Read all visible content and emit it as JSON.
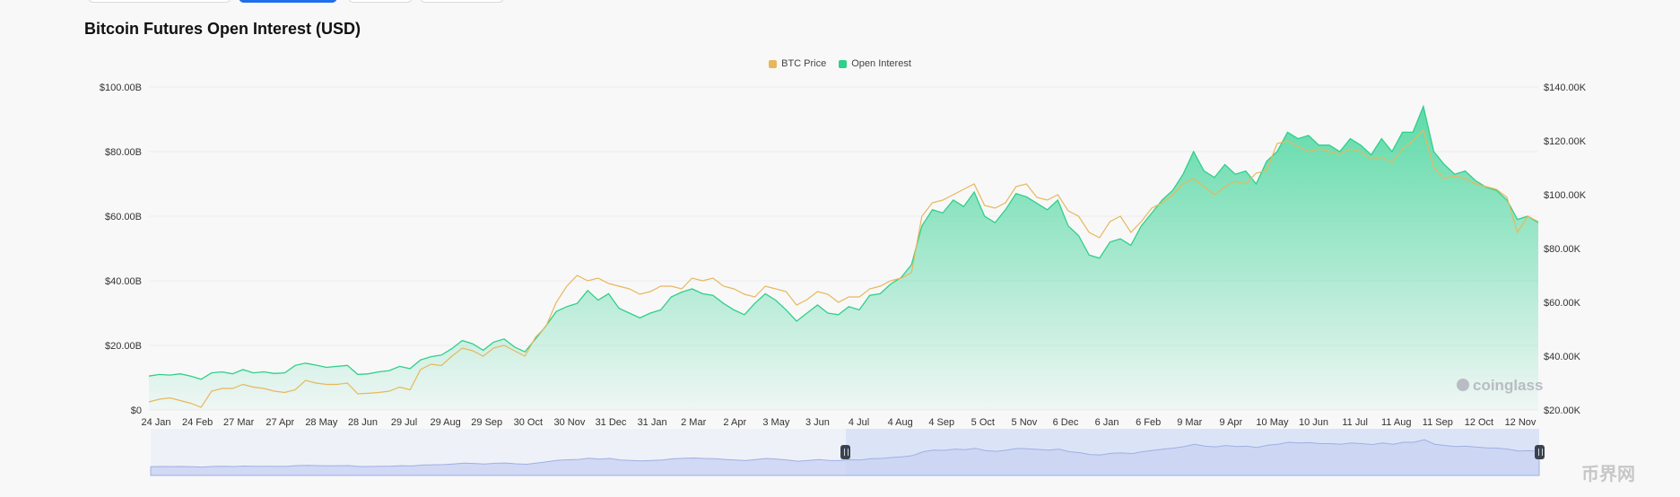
{
  "tabs_top": [
    "",
    "",
    "",
    ""
  ],
  "title": "Bitcoin Futures Open Interest (USD)",
  "legend": [
    {
      "label": "BTC Price",
      "color": "#e7b85b"
    },
    {
      "label": "Open Interest",
      "color": "#2fd089"
    }
  ],
  "watermark": "coinglass",
  "site_mark": "币界网",
  "chart_data": {
    "type": "area",
    "title": "Bitcoin Futures Open Interest (USD)",
    "x_ticks": [
      "24 Jan",
      "24 Feb",
      "27 Mar",
      "27 Apr",
      "28 May",
      "28 Jun",
      "29 Jul",
      "29 Aug",
      "29 Sep",
      "30 Oct",
      "30 Nov",
      "31 Dec",
      "31 Jan",
      "2 Mar",
      "2 Apr",
      "3 May",
      "3 Jun",
      "4 Jul",
      "4 Aug",
      "4 Sep",
      "5 Oct",
      "5 Nov",
      "6 Dec",
      "6 Jan",
      "6 Feb",
      "9 Mar",
      "9 Apr",
      "10 May",
      "10 Jun",
      "11 Jul",
      "11 Aug",
      "11 Sep",
      "12 Oct",
      "12 Nov"
    ],
    "y_left": {
      "ticks": [
        "$0",
        "$20.00B",
        "$40.00B",
        "$60.00B",
        "$80.00B",
        "$100.00B"
      ],
      "range": [
        0,
        100
      ],
      "unit": "B USD"
    },
    "y_right": {
      "ticks": [
        "$20.00K",
        "$40.00K",
        "$60.00K",
        "$80.00K",
        "$100.00K",
        "$120.00K",
        "$140.00K"
      ],
      "range": [
        20,
        140
      ],
      "unit": "K USD"
    },
    "grid": true,
    "legend_position": "top-center",
    "series": [
      {
        "name": "Open Interest",
        "axis": "left",
        "color": "#2fd089",
        "values": [
          10.5,
          11,
          10.8,
          11.2,
          10.5,
          9.5,
          11.5,
          11.8,
          11.2,
          12.5,
          11.5,
          11.8,
          11.3,
          11.5,
          13.8,
          14.5,
          13.9,
          13.2,
          13.5,
          13.8,
          11,
          11.2,
          11.8,
          12.2,
          13.5,
          12.8,
          15.5,
          16.5,
          17,
          19,
          21.5,
          20.5,
          18.5,
          21,
          22,
          19.5,
          18,
          22,
          26,
          30.5,
          32,
          33,
          37,
          34,
          36,
          31.5,
          30,
          28.5,
          30,
          31,
          35,
          36.5,
          37.5,
          36,
          35.5,
          33,
          31,
          29.5,
          33,
          36,
          34,
          31,
          27.5,
          30,
          32.5,
          30,
          29.5,
          32,
          31,
          35.5,
          36,
          39,
          41,
          45,
          57,
          62,
          61,
          65,
          63,
          67.5,
          60,
          58,
          62,
          67,
          66,
          64,
          62,
          65,
          57,
          54,
          48,
          47,
          52,
          53,
          51,
          57,
          61,
          65,
          68,
          73,
          80,
          74,
          72,
          76,
          73,
          74,
          70,
          77,
          80,
          86,
          84,
          85,
          82,
          82,
          80,
          84,
          82,
          79,
          84,
          80,
          86,
          86,
          94,
          80,
          76,
          73,
          74,
          71,
          69,
          68,
          65,
          59,
          60,
          58
        ]
      },
      {
        "name": "BTC Price",
        "axis": "right",
        "color": "#e7b85b",
        "values": [
          23,
          24,
          24.5,
          23.5,
          22.5,
          21,
          27,
          28,
          28,
          29.5,
          28.5,
          28,
          27,
          26.5,
          27.5,
          31,
          30,
          29.5,
          29.5,
          30,
          26,
          26.2,
          26.5,
          27,
          28.5,
          27.5,
          35,
          37,
          36.5,
          40,
          43,
          42,
          40,
          43,
          44,
          42,
          40,
          47,
          51,
          60,
          66,
          70,
          68,
          69,
          67,
          66,
          65,
          63,
          64,
          66,
          66,
          65,
          69,
          68,
          69,
          66,
          65,
          63,
          62,
          66,
          65,
          64,
          59,
          61,
          64,
          63,
          60,
          62,
          62,
          65,
          66,
          68,
          69,
          71,
          92,
          97,
          98,
          100,
          102,
          104,
          96,
          95,
          97,
          103,
          104,
          99,
          98,
          100,
          94,
          92,
          86,
          84,
          90,
          92,
          86,
          90,
          95,
          97,
          100,
          104,
          106,
          103,
          100,
          103,
          105,
          104,
          108,
          109,
          119,
          120,
          118,
          116,
          117,
          116,
          115,
          117,
          116,
          113,
          114,
          112,
          117,
          120,
          124,
          110,
          106,
          107,
          106,
          104,
          103,
          102,
          99,
          86,
          92,
          90
        ]
      }
    ],
    "navigator": {
      "range_start_label": "4 Jul",
      "range_end_label": "12 Nov"
    }
  }
}
